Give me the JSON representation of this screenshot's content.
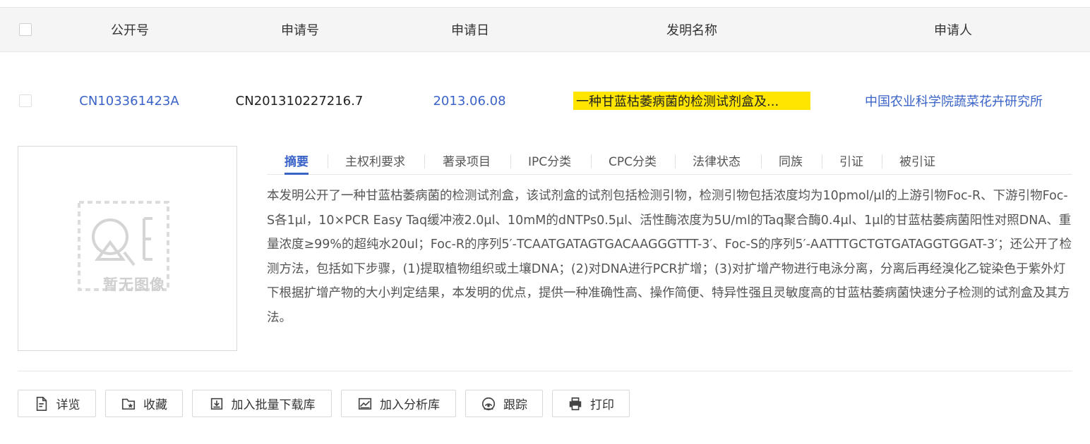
{
  "table_header": {
    "col_pub": "公开号",
    "col_app": "申请号",
    "col_date": "申请日",
    "col_title": "发明名称",
    "col_applicant": "申请人"
  },
  "record": {
    "pub_no": "CN103361423A",
    "app_no": "CN201310227216.7",
    "app_date": "2013.06.08",
    "title": "一种甘蓝枯萎病菌的检测试剂盒及...",
    "applicant": "中国农业科学院蔬菜花卉研究所"
  },
  "placeholder": {
    "text": "暂无图像"
  },
  "tabs": [
    "摘要",
    "主权利要求",
    "著录项目",
    "IPC分类",
    "CPC分类",
    "法律状态",
    "同族",
    "引证",
    "被引证"
  ],
  "abstract": "本发明公开了一种甘蓝枯萎病菌的检测试剂盒，该试剂盒的试剂包括检测引物，检测引物包括浓度均为10pmol/μl的上游引物Foc-R、下游引物Foc-S各1μl，10×PCR Easy Taq缓冲液2.0μl、10mM的dNTPs0.5μl、活性酶浓度为5U/ml的Taq聚合酶0.4μl、1μl的甘蓝枯萎病菌阳性对照DNA、重量浓度≥99%的超纯水20ul；Foc-R的序列5′-TCAATGATAGTGACAAGGGTTT-3′、Foc-S的序列5′-AATTTGCTGTGATAGGTGGAT-3′；还公开了检测方法，包括如下步骤，(1)提取植物组织或土壤DNA；(2)对DNA进行PCR扩增；(3)对扩增产物进行电泳分离，分离后再经溴化乙锭染色于紫外灯下根据扩增产物的大小判定结果，本发明的优点，提供一种准确性高、操作简便、特异性强且灵敏度高的甘蓝枯萎病菌快速分子检测的试剂盒及其方法。",
  "actions": {
    "detail": "详览",
    "favorite": "收藏",
    "batch_download": "加入批量下载库",
    "analysis": "加入分析库",
    "track": "跟踪",
    "print": "打印"
  },
  "colors": {
    "link": "#3a63c7",
    "highlight": "#ffe500",
    "header_bg": "#f5f5f5"
  }
}
